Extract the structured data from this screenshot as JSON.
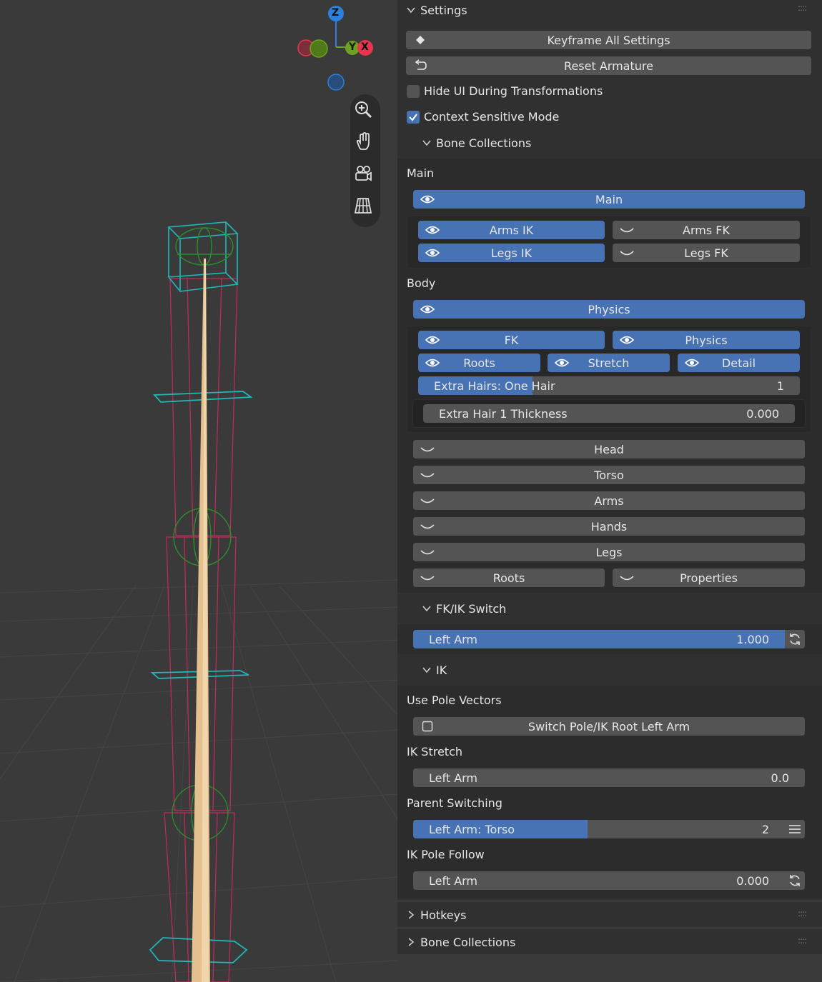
{
  "gizmo": {
    "z_label": "Z",
    "y_label": "Y",
    "x_label": "X"
  },
  "nav_tools": [
    {
      "name": "zoom-icon"
    },
    {
      "name": "pan-hand-icon"
    },
    {
      "name": "camera-icon"
    },
    {
      "name": "perspective-grid-icon"
    }
  ],
  "settings": {
    "title": "Settings",
    "keyframe_all": "Keyframe All Settings",
    "reset_armature": "Reset Armature",
    "hide_ui": {
      "label": "Hide UI During Transformations",
      "checked": false
    },
    "context_sensitive": {
      "label": "Context Sensitive Mode",
      "checked": true
    }
  },
  "bone_collections_sub": {
    "title": "Bone Collections",
    "main_heading": "Main",
    "main_button": "Main",
    "main_grid": [
      {
        "label": "Arms IK",
        "visible": true
      },
      {
        "label": "Arms FK",
        "visible": false
      },
      {
        "label": "Legs IK",
        "visible": true
      },
      {
        "label": "Legs FK",
        "visible": false
      }
    ],
    "body_heading": "Body",
    "physics_button": "Physics",
    "physics_row1": [
      {
        "label": "FK",
        "visible": true
      },
      {
        "label": "Physics",
        "visible": true
      }
    ],
    "physics_row2": [
      {
        "label": "Roots",
        "visible": true
      },
      {
        "label": "Stretch",
        "visible": true
      },
      {
        "label": "Detail",
        "visible": true
      }
    ],
    "extra_hairs": {
      "label": "Extra Hairs: One Hair",
      "value": "1",
      "fill": 0.3
    },
    "extra_hair_thickness": {
      "label": "Extra Hair 1 Thickness",
      "value": "0.000"
    },
    "hidden_rows": [
      "Head",
      "Torso",
      "Arms",
      "Hands",
      "Legs"
    ],
    "roots": "Roots",
    "properties": "Properties"
  },
  "fkik": {
    "title": "FK/IK Switch",
    "left_arm": {
      "label": "Left Arm",
      "value": "1.000",
      "fill": 1.0
    }
  },
  "ik": {
    "title": "IK",
    "pole_heading": "Use Pole Vectors",
    "switch_pole": {
      "label": "Switch Pole/IK Root Left Arm",
      "checked": false
    },
    "stretch_heading": "IK Stretch",
    "stretch": {
      "label": "Left Arm",
      "value": "0.0",
      "fill": 0.0
    },
    "parent_heading": "Parent Switching",
    "parent": {
      "label": "Left Arm: Torso",
      "value": "2",
      "fill": 0.47
    },
    "pole_follow_heading": "IK Pole Follow",
    "pole_follow": {
      "label": "Left Arm",
      "value": "0.000",
      "fill": 0.0
    }
  },
  "hotkeys": {
    "title": "Hotkeys"
  },
  "bone_collections_panel": {
    "title": "Bone Collections"
  },
  "colors": {
    "accent_blue": "#4772b3",
    "button_gray": "#545454",
    "panel_bg": "#303030",
    "viewport_bg": "#3a3a3a",
    "axis_x": "#e8344e",
    "axis_y": "#6da31f",
    "axis_z": "#2c7fdc"
  }
}
